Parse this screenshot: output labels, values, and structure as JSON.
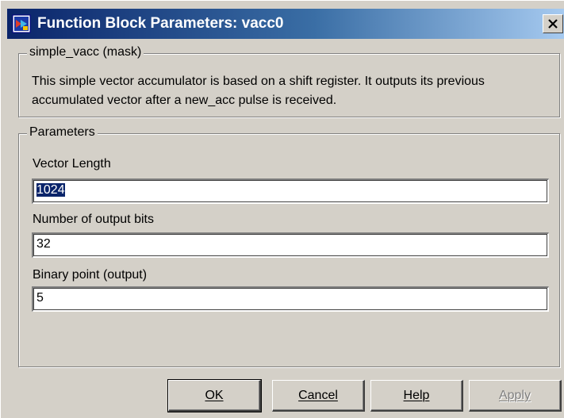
{
  "window": {
    "title": "Function Block Parameters: vacc0",
    "close_glyph": "✕"
  },
  "mask_group": {
    "legend": "simple_vacc (mask)",
    "description": "This simple vector accumulator is based on a shift register. It outputs its previous accumulated vector after a new_acc pulse is received."
  },
  "params_group": {
    "legend": "Parameters",
    "fields": [
      {
        "label": "Vector Length",
        "value": "1024"
      },
      {
        "label": "Number of output bits",
        "value": "32"
      },
      {
        "label": "Binary point (output)",
        "value": "5"
      }
    ]
  },
  "buttons": {
    "ok": "OK",
    "cancel": "Cancel",
    "help": "Help",
    "apply": "Apply"
  },
  "colors": {
    "titlebar_start": "#0a246a",
    "titlebar_end": "#a6caf0",
    "dialog_bg": "#d4d0c8",
    "selection": "#0a246a"
  },
  "icons": {
    "title": "simulink-block-icon",
    "close": "close-icon"
  }
}
